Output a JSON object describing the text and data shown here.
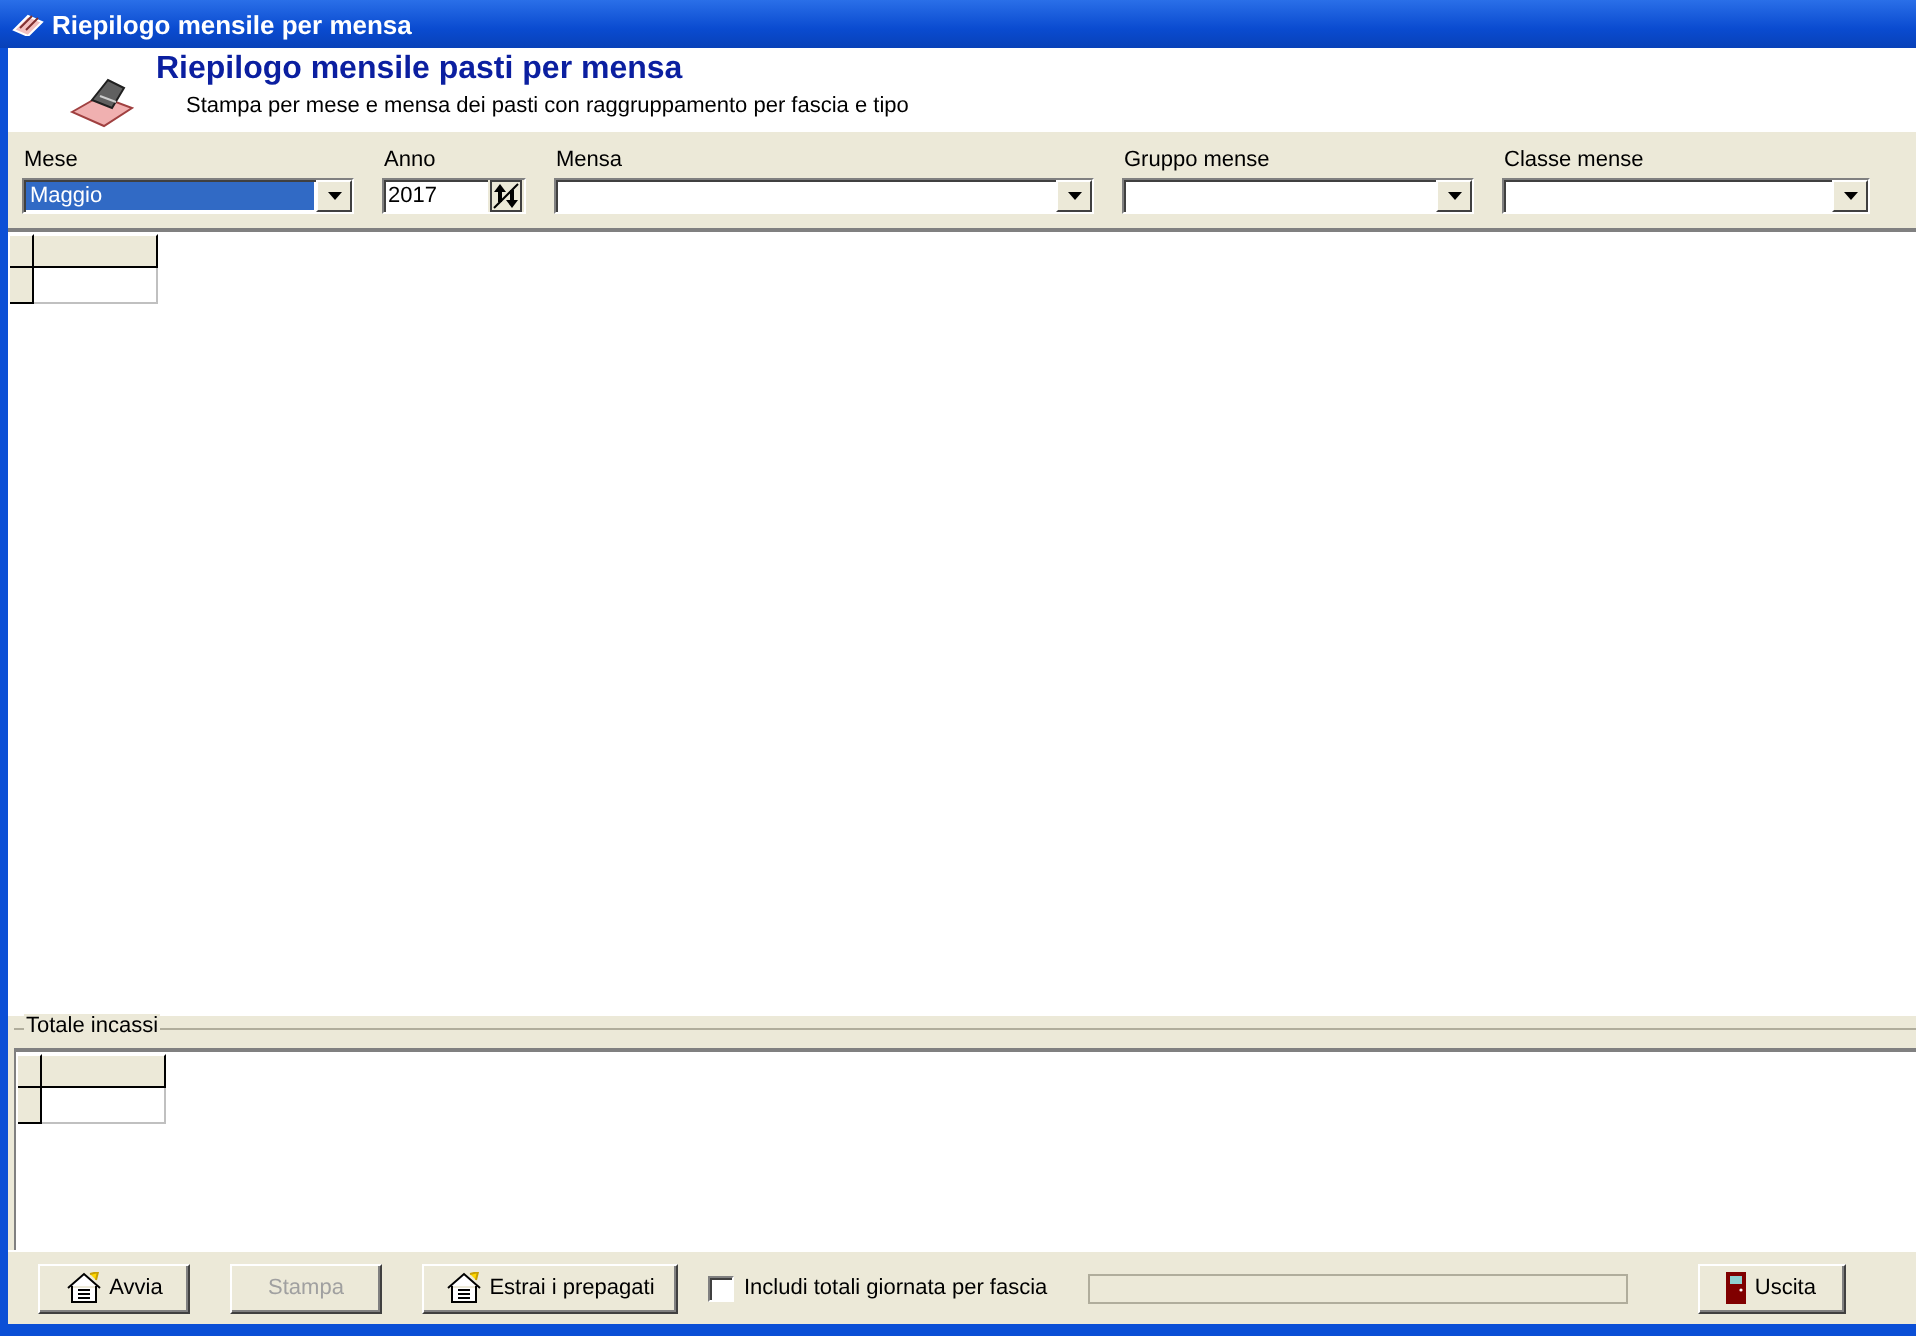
{
  "window": {
    "title": "Riepilogo mensile per mensa"
  },
  "header": {
    "title": "Riepilogo mensile pasti per mensa",
    "subtitle": "Stampa per mese e mensa dei pasti con raggruppamento per fascia e tipo"
  },
  "filters": [
    {
      "kind": "combo",
      "label": "Mese",
      "value": "Maggio",
      "focused": true
    },
    {
      "kind": "spin",
      "label": "Anno",
      "value": "2017",
      "focused": false
    },
    {
      "kind": "combo",
      "label": "Mensa",
      "focused": false
    },
    {
      "kind": "combo",
      "label": "Gruppo mense",
      "focused": false
    },
    {
      "kind": "combo",
      "label": "Classe mense",
      "focused": false
    }
  ],
  "totals": {
    "title": "Totale incassi"
  },
  "buttons": [
    {
      "kind": "icon",
      "label": "Avvia",
      "disabled": false
    },
    {
      "kind": "plain",
      "label": "Stampa",
      "disabled": true
    },
    {
      "kind": "icon",
      "label": "Estrai i prepagati",
      "disabled": false
    }
  ],
  "option": {
    "label": "Includi totali giornata per fascia",
    "checked": false
  },
  "progress": {
    "level": 0
  },
  "exit_button": {
    "label": "Uscita"
  }
}
